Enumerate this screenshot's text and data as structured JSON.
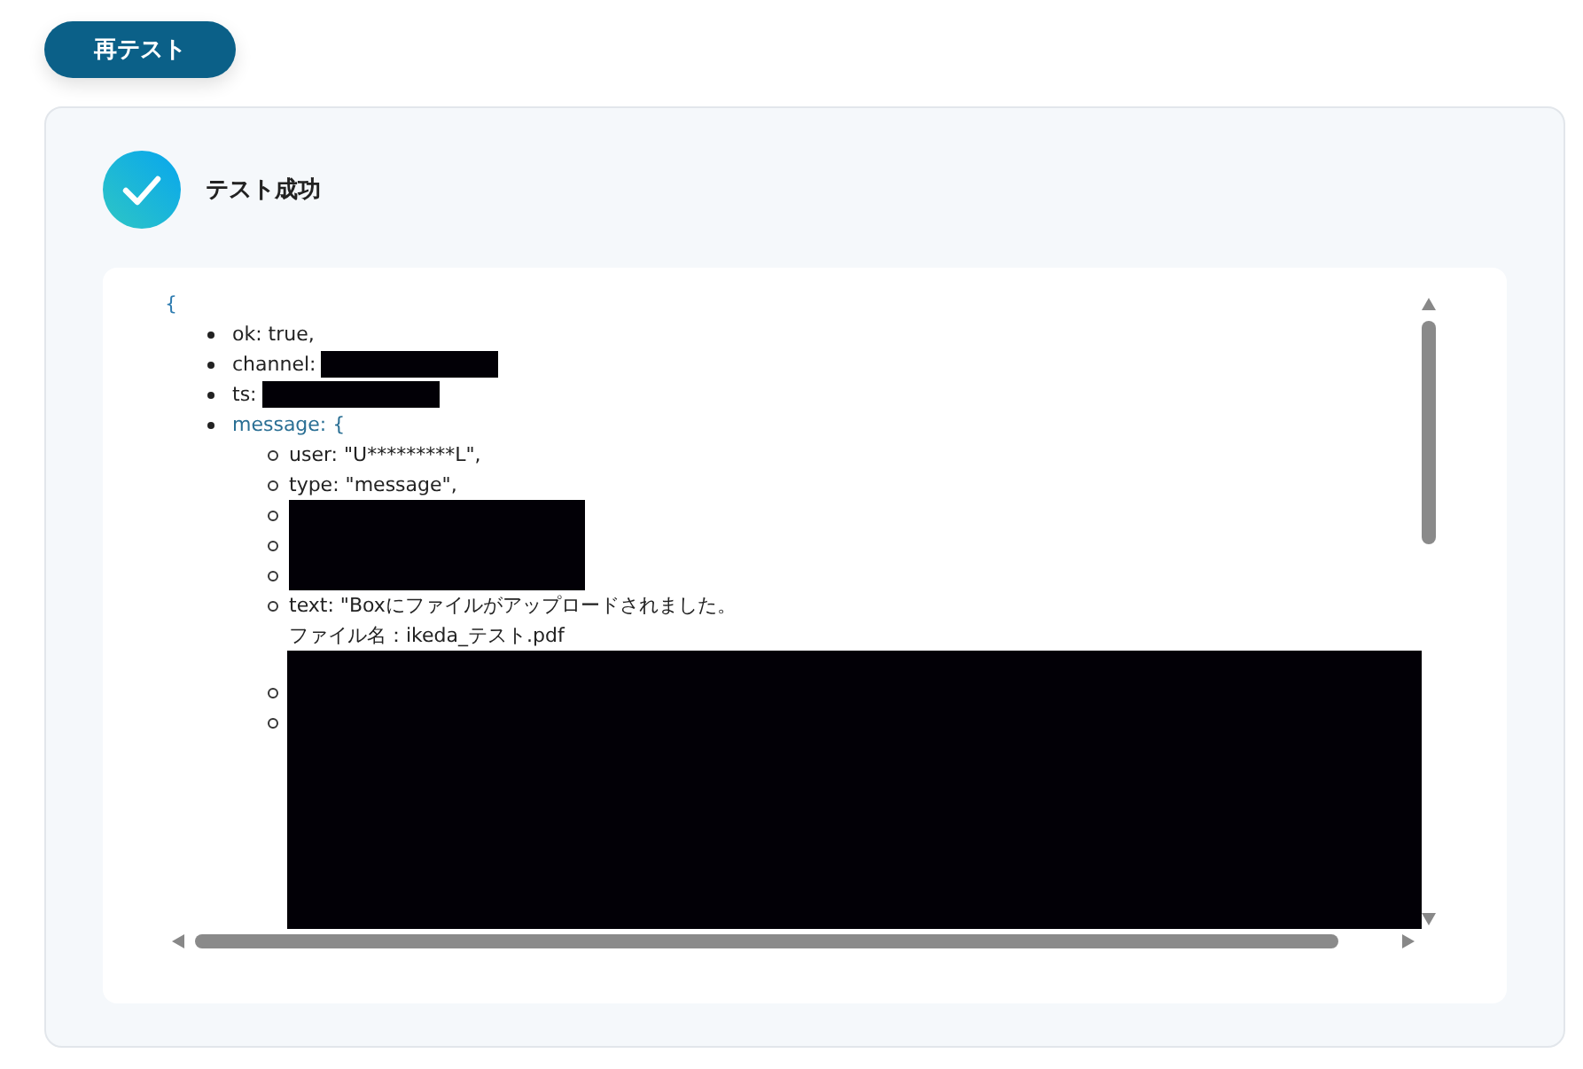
{
  "retest_button": {
    "label": "再テスト"
  },
  "result": {
    "title": "テスト成功"
  },
  "output": {
    "open": "{",
    "items": [
      {
        "kind": "field",
        "label": "ok: true,"
      },
      {
        "kind": "redacted_field",
        "label": "channel:"
      },
      {
        "kind": "redacted_field",
        "label": "ts:"
      },
      {
        "kind": "object",
        "label": "message: {",
        "children": [
          {
            "kind": "field",
            "label": "user: \"U*********L\","
          },
          {
            "kind": "field",
            "label": "type: \"message\","
          },
          {
            "kind": "redacted"
          },
          {
            "kind": "redacted"
          },
          {
            "kind": "redacted"
          },
          {
            "kind": "multiline",
            "lines": [
              "text: \"Boxにファイルがアップロードされました。",
              "ファイル名：ikeda_テスト.pdf"
            ]
          },
          {
            "kind": "under_block"
          },
          {
            "kind": "under_block"
          }
        ]
      }
    ]
  }
}
